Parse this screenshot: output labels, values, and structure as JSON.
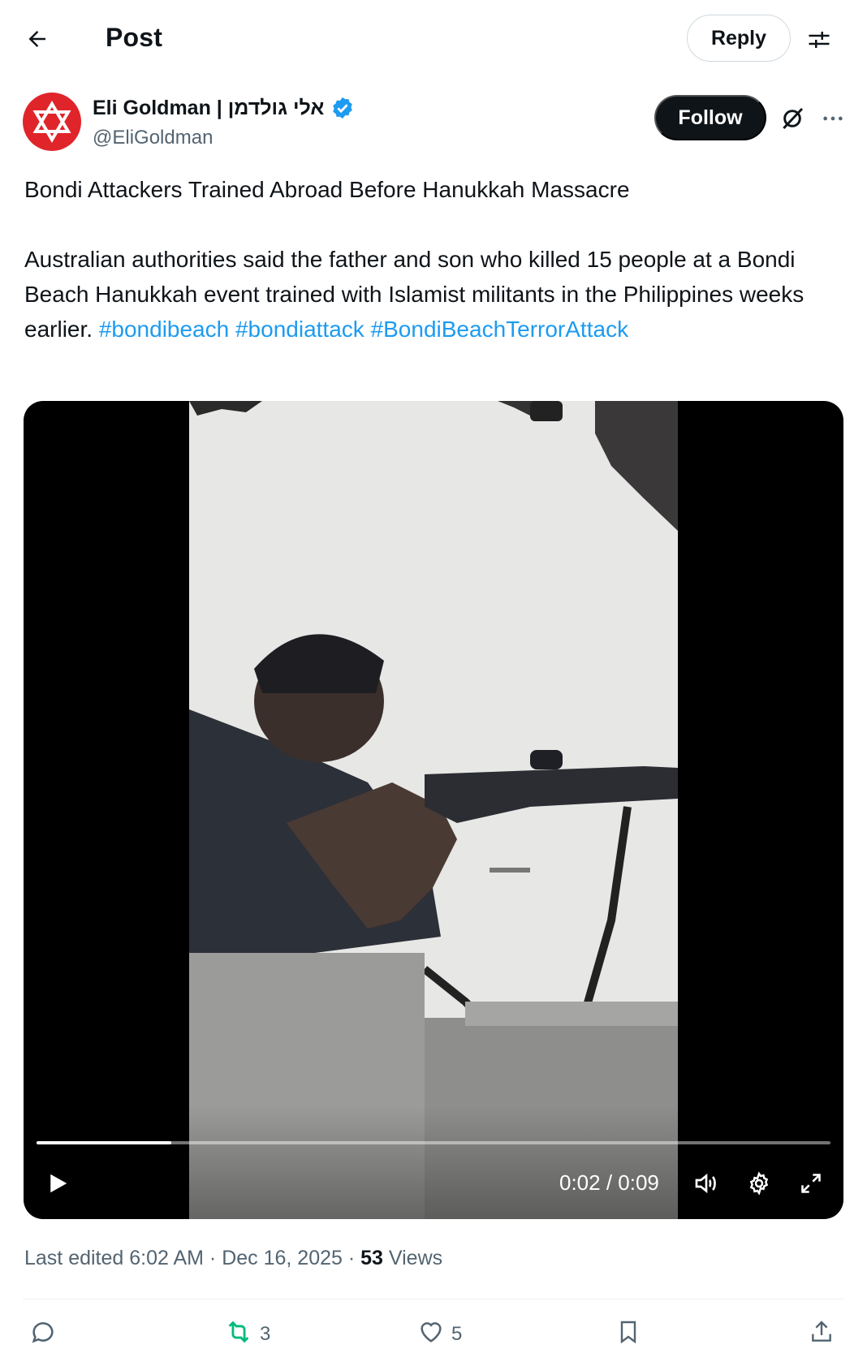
{
  "header": {
    "title": "Post",
    "reply_label": "Reply"
  },
  "author": {
    "name": "Eli Goldman | אלי גולדמן",
    "handle": "@EliGoldman",
    "verified": true,
    "avatar_color": "#e0252a",
    "follow_label": "Follow"
  },
  "post": {
    "headline": "Bondi Attackers Trained Abroad Before Hanukkah Massacre",
    "body": "Australian authorities said the father and son who killed 15 people at a Bondi Beach Hanukkah event trained with Islamist militants in the Philippines weeks earlier.",
    "hashtags": [
      "#bondibeach",
      "#bondiattack",
      "#BondiBeachTerrorAttack"
    ]
  },
  "video": {
    "time_display": "0:02 / 0:09",
    "progress": 0.17
  },
  "meta": {
    "edited_prefix": "Last edited 6:02 AM · Dec 16, 2025 · ",
    "views_count": "53",
    "views_label": " Views"
  },
  "actions": {
    "replies": "",
    "reposts": "3",
    "likes": "5"
  },
  "colors": {
    "link": "#1d9bf0",
    "verified": "#1d9bf0",
    "repost_active": "#00ba7c"
  }
}
